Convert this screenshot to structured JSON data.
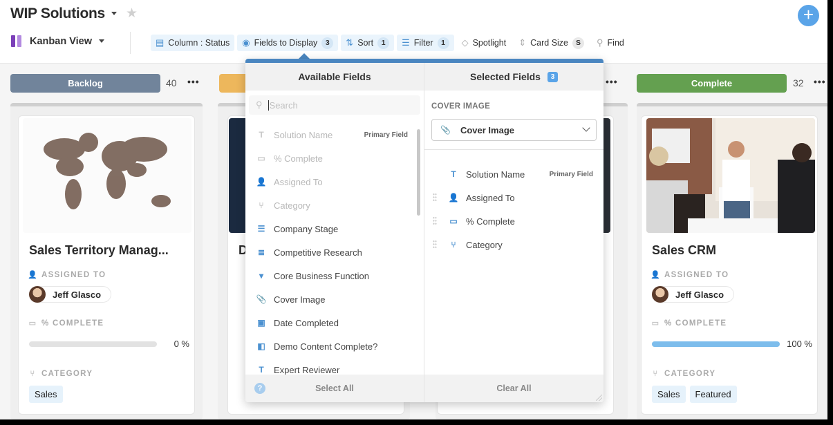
{
  "header": {
    "title": "WIP Solutions",
    "view_label": "Kanban View",
    "view_icon_colors": [
      "#7b3fb8",
      "#b38ae0"
    ],
    "add_button": "+"
  },
  "toolbar": {
    "column": "Column : Status",
    "fields": "Fields to Display",
    "fields_count": "3",
    "sort": "Sort",
    "sort_count": "1",
    "filter": "Filter",
    "filter_count": "1",
    "spotlight": "Spotlight",
    "card_size": "Card Size",
    "card_size_value": "S",
    "find": "Find"
  },
  "columns": [
    {
      "name": "Backlog",
      "count": "40",
      "color": "#71849b",
      "card": {
        "title": "Sales Territory Manag...",
        "image": "world-map-crowd",
        "assigned_label": "ASSIGNED TO",
        "assigned_to": "Jeff Glasco",
        "complete_label": "% COMPLETE",
        "percent_complete": 0,
        "percent_text": "0 %",
        "category_label": "CATEGORY",
        "categories": [
          "Sales"
        ]
      }
    },
    {
      "name": "",
      "count": "",
      "color": "#edb75c",
      "card": {
        "title": "D"
      }
    },
    {
      "name": "",
      "count": "",
      "color": "#efefef",
      "card": {}
    },
    {
      "name": "Complete",
      "count": "32",
      "color": "#64a050",
      "card": {
        "title": "Sales CRM",
        "image": "office-celebration",
        "assigned_label": "ASSIGNED TO",
        "assigned_to": "Jeff Glasco",
        "complete_label": "% COMPLETE",
        "percent_complete": 100,
        "percent_text": "100 %",
        "category_label": "CATEGORY",
        "categories": [
          "Sales",
          "Featured"
        ]
      }
    }
  ],
  "popup": {
    "available_title": "Available Fields",
    "search_placeholder": "Search",
    "primary_field_tag": "Primary Field",
    "available_fields": [
      {
        "label": "Solution Name",
        "icon": "T",
        "disabled": true,
        "primary": true
      },
      {
        "label": "% Complete",
        "icon": "▭",
        "disabled": true
      },
      {
        "label": "Assigned To",
        "icon": "👤",
        "disabled": true
      },
      {
        "label": "Category",
        "icon": "⑂",
        "disabled": true
      },
      {
        "label": "Company Stage",
        "icon": "☰",
        "disabled": false
      },
      {
        "label": "Competitive Research",
        "icon": "≣",
        "disabled": false
      },
      {
        "label": "Core Business Function",
        "icon": "▾",
        "disabled": false
      },
      {
        "label": "Cover Image",
        "icon": "📎",
        "disabled": false
      },
      {
        "label": "Date Completed",
        "icon": "▣",
        "disabled": false
      },
      {
        "label": "Demo Content Complete?",
        "icon": "◧",
        "disabled": false
      },
      {
        "label": "Expert Reviewer",
        "icon": "T",
        "disabled": false
      }
    ],
    "select_all": "Select All",
    "selected_title": "Selected Fields",
    "selected_count": "3",
    "cover_image_label": "COVER IMAGE",
    "cover_image_value": "Cover Image",
    "selected_fields": [
      {
        "label": "Solution Name",
        "icon": "T",
        "primary": true
      },
      {
        "label": "Assigned To",
        "icon": "👤"
      },
      {
        "label": "% Complete",
        "icon": "▭"
      },
      {
        "label": "Category",
        "icon": "⑂"
      }
    ],
    "clear_all": "Clear All"
  }
}
